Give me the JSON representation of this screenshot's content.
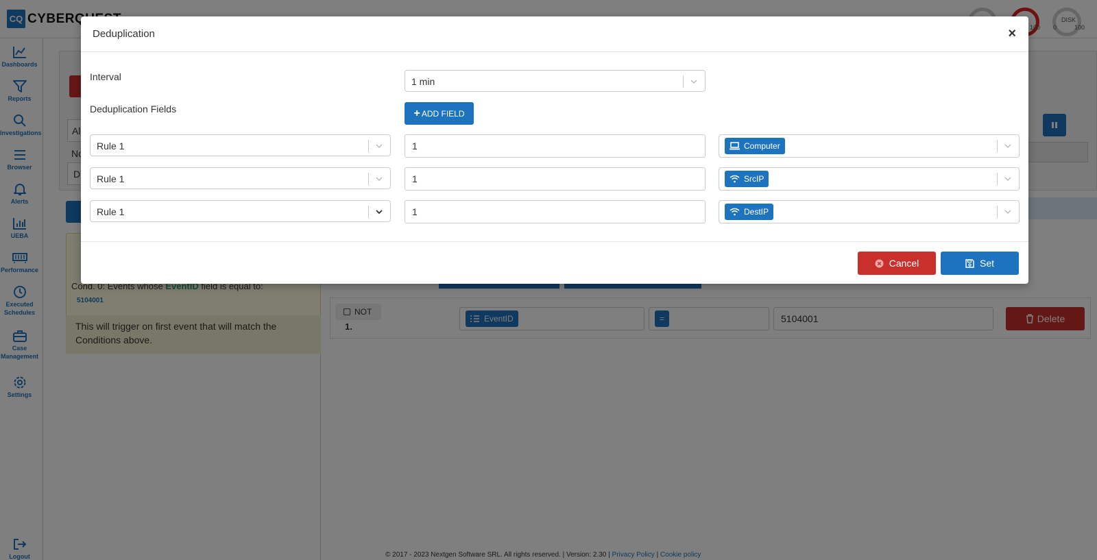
{
  "app": {
    "logo_abbr": "CQ",
    "logo_name": "CYBERQUEST"
  },
  "gauges": {
    "g1_max": "100",
    "disk_label": "DISK",
    "disk_min": "0",
    "disk_max": "100"
  },
  "sidebar": {
    "items": [
      {
        "label": "Dashboards",
        "icon": "chart-line-icon"
      },
      {
        "label": "Reports",
        "icon": "filter-icon"
      },
      {
        "label": "Investigations",
        "icon": "search-icon"
      },
      {
        "label": "Browser",
        "icon": "list-icon"
      },
      {
        "label": "Alerts",
        "icon": "bell-icon"
      },
      {
        "label": "UEBA",
        "icon": "bar-chart-icon"
      },
      {
        "label": "Performance",
        "icon": "memory-icon"
      },
      {
        "label": "Executed Schedules",
        "icon": "clock-icon"
      },
      {
        "label": "Case Management",
        "icon": "briefcase-icon"
      },
      {
        "label": "Settings",
        "icon": "gear-icon"
      },
      {
        "label": "Logout",
        "icon": "logout-icon"
      }
    ]
  },
  "background": {
    "frag_al": "Al",
    "frag_no": "No",
    "frag_d": "D",
    "condition": {
      "prefix": "Cond. 0: Events whose",
      "field": "EventID",
      "suffix": "field is equal to:",
      "value": "5104001",
      "description": "This will trigger on first event that will match the Conditions above."
    },
    "rule": {
      "not_label": "NOT",
      "number": "1.",
      "field_tag": "EventID",
      "operator_tag": "=",
      "value": "5104001",
      "delete_label": "Delete"
    },
    "footer": {
      "copyright": "© 2017 - 2023 Nextgen Software SRL. All rights reserved. | Version: 2.30 |",
      "privacy": "Privacy Policy",
      "sep": "|",
      "cookie": "Cookie policy"
    }
  },
  "modal": {
    "title": "Deduplication",
    "close": "×",
    "interval_label": "Interval",
    "interval_value": "1 min",
    "fields_label": "Deduplication Fields",
    "add_field_label": "ADD FIELD",
    "rows": [
      {
        "rule": "Rule 1",
        "count": "1",
        "field": "Computer",
        "field_icon": "laptop-icon"
      },
      {
        "rule": "Rule 1",
        "count": "1",
        "field": "SrcIP",
        "field_icon": "wifi-icon"
      },
      {
        "rule": "Rule 1",
        "count": "1",
        "field": "DestIP",
        "field_icon": "wifi-icon"
      }
    ],
    "cancel_label": "Cancel",
    "set_label": "Set"
  },
  "colors": {
    "primary": "#1e73be",
    "danger": "#c9302c"
  }
}
